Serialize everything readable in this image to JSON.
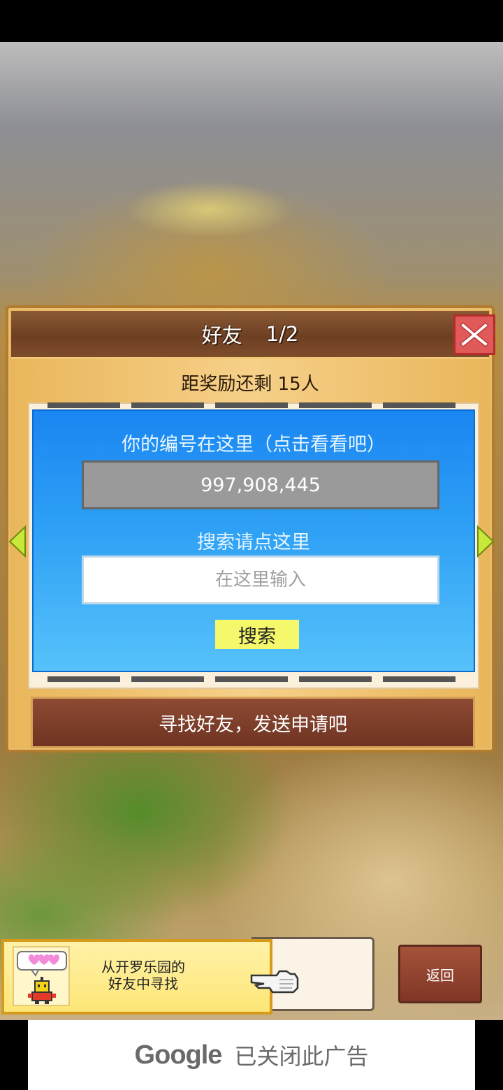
{
  "dialog": {
    "title": "好友",
    "page": "1/2",
    "reward_text": "距奖励还剩 15人",
    "id_label": "你的编号在这里（点击看看吧）",
    "id_value": "997,908,445",
    "search_label": "搜索请点这里",
    "search_placeholder": "在这里输入",
    "search_button": "搜索",
    "find_friends_button": "寻找好友，发送申请吧"
  },
  "banner": {
    "line1": "从开罗乐园的",
    "line2": "好友中寻找"
  },
  "back_button": "返回",
  "ad": {
    "logo": "Google",
    "text": "已关闭此广告"
  },
  "colors": {
    "panel_blue": "#1a86f2",
    "header_brown": "#7a4a2a",
    "close_red": "#e05a5a",
    "search_yellow": "#f4f86a",
    "arrow_green": "#c8e83a"
  }
}
